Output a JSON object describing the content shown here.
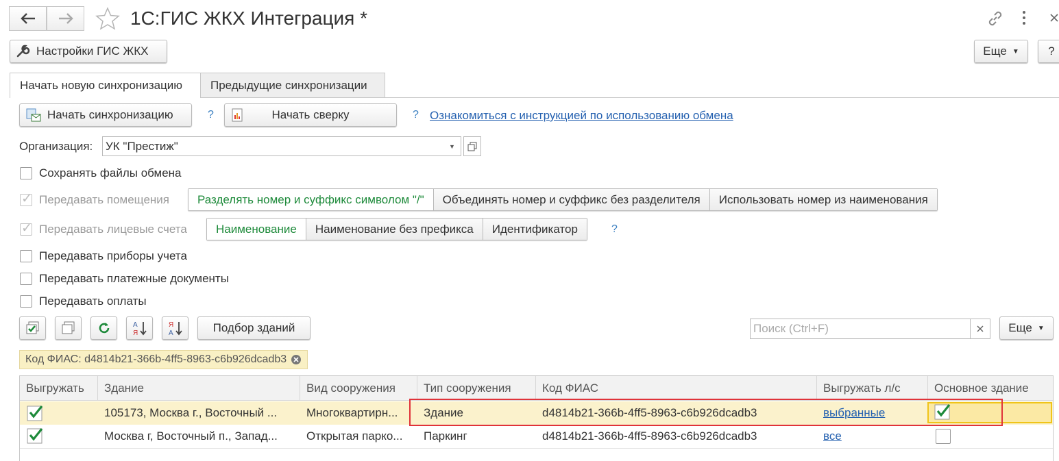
{
  "window": {
    "title": "1С:ГИС ЖКХ Интеграция *"
  },
  "toolbar": {
    "settings_label": "Настройки ГИС ЖКХ",
    "more_label": "Еще",
    "help_label": "?"
  },
  "tabs": [
    {
      "label": "Начать новую синхронизацию",
      "active": true
    },
    {
      "label": "Предыдущие синхронизации",
      "active": false
    }
  ],
  "actions": {
    "start_sync_label": "Начать синхронизацию",
    "start_reconcile_label": "Начать сверку",
    "help_q1": "?",
    "help_q2": "?",
    "instruction_link": "Ознакомиться с инструкцией по использованию обмена"
  },
  "organization": {
    "label": "Организация:",
    "value": "УК \"Престиж\""
  },
  "options": {
    "save_files": {
      "label": "Сохранять файлы обмена",
      "checked": false
    },
    "premises": {
      "label": "Передавать помещения",
      "checked": true,
      "disabled": true,
      "choices": [
        "Разделять номер и суффикс символом \"/\"",
        "Объединять номер и суффикс без разделителя",
        "Использовать номер из наименования"
      ],
      "selected": 0
    },
    "accounts": {
      "label": "Передавать лицевые счета",
      "checked": true,
      "disabled": true,
      "choices": [
        "Наименование",
        "Наименование без префикса",
        "Идентификатор"
      ],
      "selected": 0,
      "help": "?"
    },
    "meters": {
      "label": "Передавать приборы учета",
      "checked": false
    },
    "payment_docs": {
      "label": "Передавать платежные документы",
      "checked": false
    },
    "payments": {
      "label": "Передавать оплаты",
      "checked": false
    }
  },
  "list_toolbar": {
    "select_buildings_label": "Подбор зданий",
    "search_placeholder": "Поиск (Ctrl+F)",
    "more_label": "Еще"
  },
  "filter": {
    "chip_text": "Код ФИАС: d4814b21-366b-4ff5-8963-c6b926dcadb3"
  },
  "table": {
    "columns": [
      "Выгружать",
      "Здание",
      "Вид сооружения",
      "Тип сооружения",
      "Код ФИАС",
      "Выгружать л/с",
      "Основное здание"
    ],
    "rows": [
      {
        "export": true,
        "building": "105173, Москва г., Восточный ...",
        "kind": "Многоквартирн...",
        "type": "Здание",
        "fias": "d4814b21-366b-4ff5-8963-c6b926dcadb3",
        "export_accounts": "выбранные",
        "main": true
      },
      {
        "export": true,
        "building": "Москва г, Восточный п., Запад...",
        "kind": "Открытая парко...",
        "type": "Паркинг",
        "fias": "d4814b21-366b-4ff5-8963-c6b926dcadb3",
        "export_accounts": "все",
        "main": false
      }
    ]
  },
  "colors": {
    "accent_green": "#1d8a3a",
    "link_blue": "#2561b0",
    "selected_row": "#fbf2cc",
    "highlight_red": "#e0333a"
  }
}
